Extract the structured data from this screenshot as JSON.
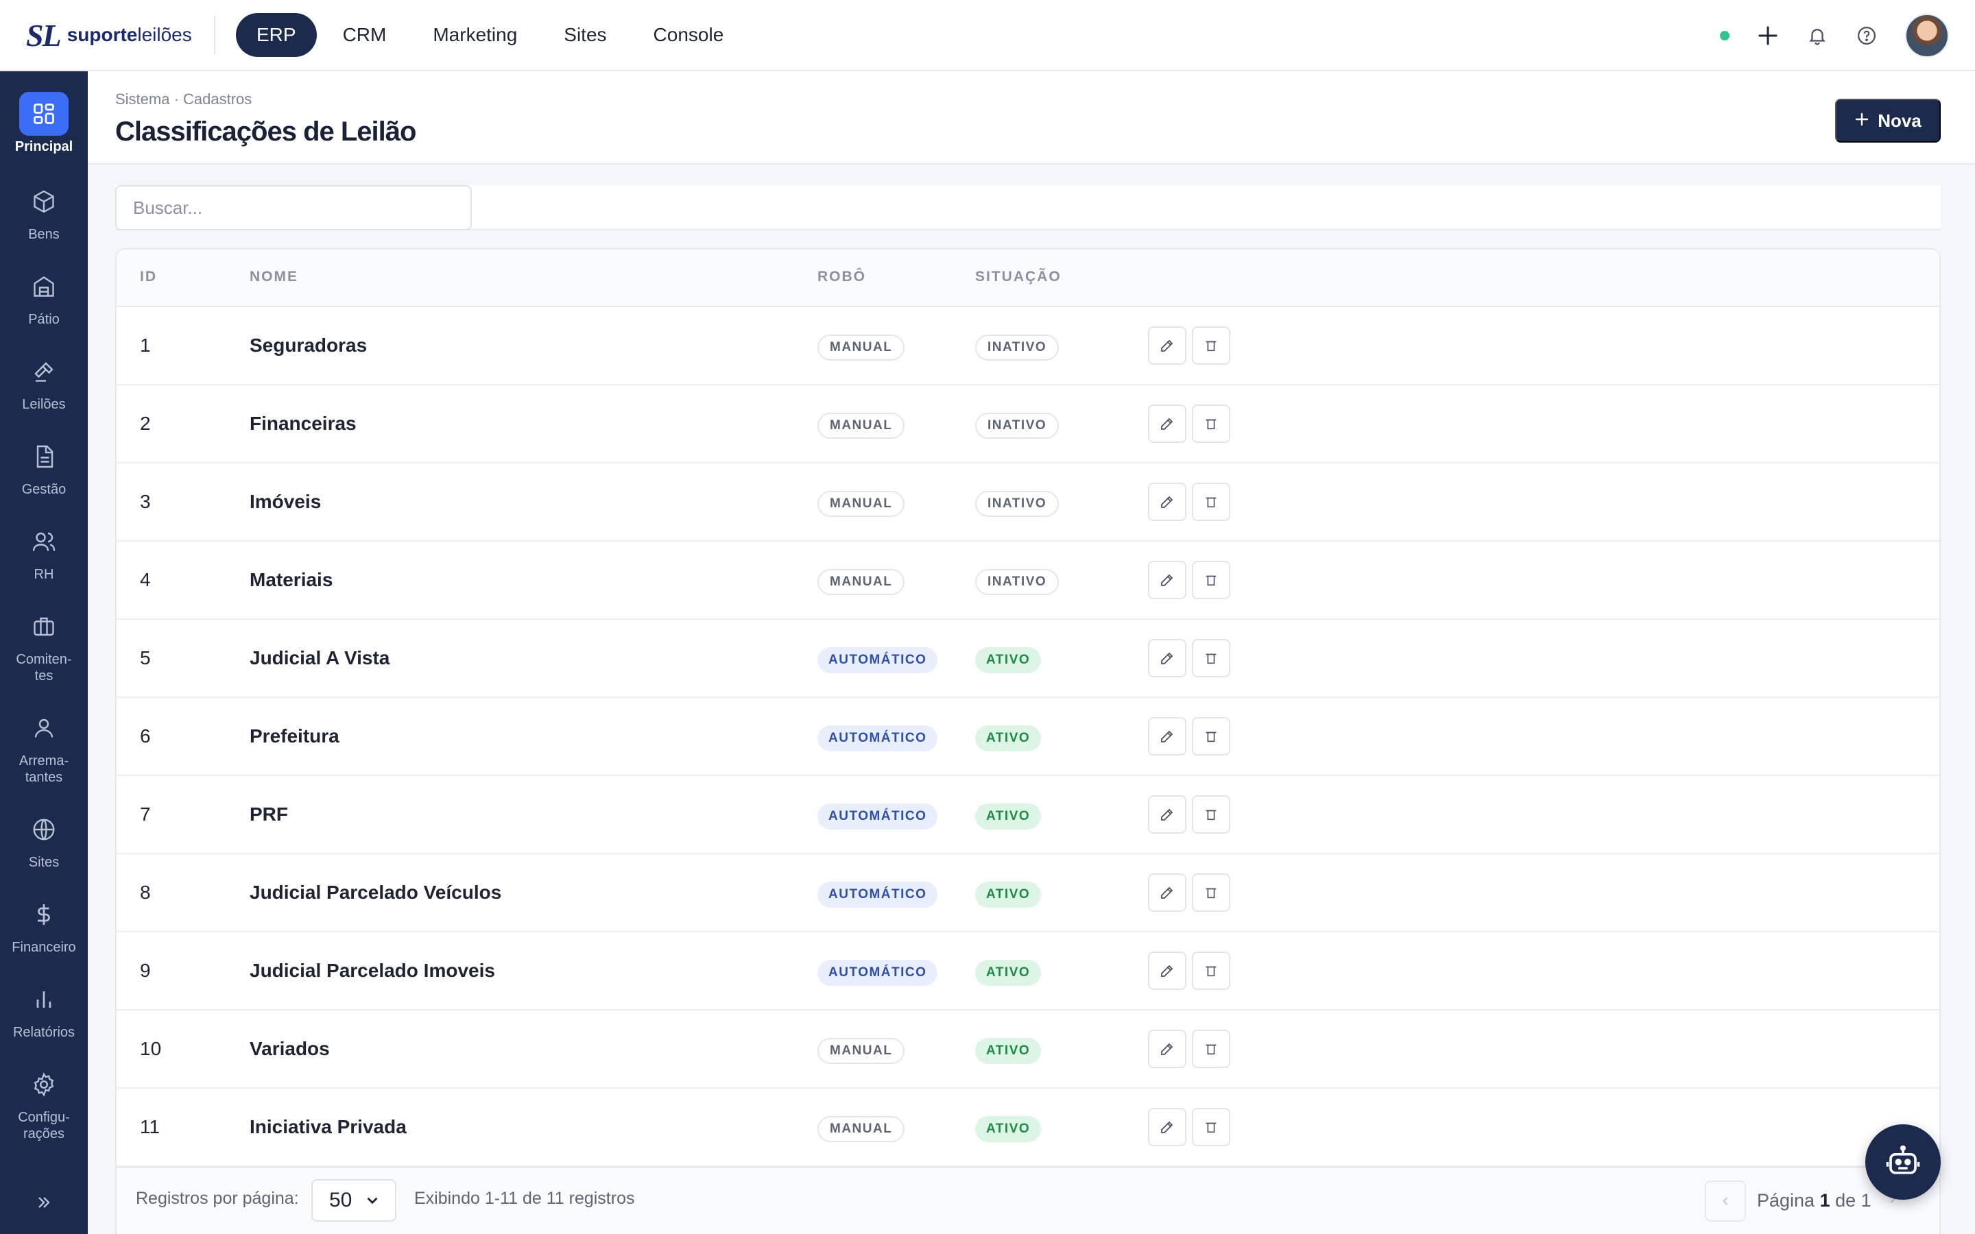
{
  "brand": {
    "mark": "SL",
    "name_bold": "suporte",
    "name_light": "leilões"
  },
  "topnav": [
    {
      "label": "ERP",
      "active": true
    },
    {
      "label": "CRM",
      "active": false
    },
    {
      "label": "Marketing",
      "active": false
    },
    {
      "label": "Sites",
      "active": false
    },
    {
      "label": "Console",
      "active": false
    }
  ],
  "topbar_icons": [
    "status-online-dot",
    "plus-icon",
    "bell-icon",
    "help-icon",
    "user-avatar"
  ],
  "sidebar": [
    {
      "label": "Principal",
      "icon": "dashboard-icon",
      "active": true
    },
    {
      "label": "Bens",
      "icon": "box-icon"
    },
    {
      "label": "Pátio",
      "icon": "warehouse-icon"
    },
    {
      "label": "Leilões",
      "icon": "gavel-icon"
    },
    {
      "label": "Gestão",
      "icon": "document-icon"
    },
    {
      "label": "RH",
      "icon": "users-icon"
    },
    {
      "label": "Comiten-\ntes",
      "icon": "briefcase-icon"
    },
    {
      "label": "Arrema-\ntantes",
      "icon": "user-icon"
    },
    {
      "label": "Sites",
      "icon": "globe-icon"
    },
    {
      "label": "Financeiro",
      "icon": "dollar-icon"
    },
    {
      "label": "Relatórios",
      "icon": "bar-chart-icon"
    },
    {
      "label": "Configu-\nrações",
      "icon": "gear-icon"
    }
  ],
  "page": {
    "breadcrumb": "Sistema · Cadastros",
    "title": "Classificações de Leilão",
    "new_button": "Nova"
  },
  "search": {
    "placeholder": "Buscar..."
  },
  "table": {
    "columns": {
      "id": "ID",
      "name": "NOME",
      "robot": "ROBÔ",
      "status": "SITUAÇÃO"
    },
    "rows": [
      {
        "id": "1",
        "name": "Seguradoras",
        "robot": "MANUAL",
        "status": "INATIVO"
      },
      {
        "id": "2",
        "name": "Financeiras",
        "robot": "MANUAL",
        "status": "INATIVO"
      },
      {
        "id": "3",
        "name": "Imóveis",
        "robot": "MANUAL",
        "status": "INATIVO"
      },
      {
        "id": "4",
        "name": "Materiais",
        "robot": "MANUAL",
        "status": "INATIVO"
      },
      {
        "id": "5",
        "name": "Judicial A Vista",
        "robot": "AUTOMÁTICO",
        "status": "ATIVO"
      },
      {
        "id": "6",
        "name": "Prefeitura",
        "robot": "AUTOMÁTICO",
        "status": "ATIVO"
      },
      {
        "id": "7",
        "name": "PRF",
        "robot": "AUTOMÁTICO",
        "status": "ATIVO"
      },
      {
        "id": "8",
        "name": "Judicial Parcelado Veículos",
        "robot": "AUTOMÁTICO",
        "status": "ATIVO"
      },
      {
        "id": "9",
        "name": "Judicial Parcelado Imoveis",
        "robot": "AUTOMÁTICO",
        "status": "ATIVO"
      },
      {
        "id": "10",
        "name": "Variados",
        "robot": "MANUAL",
        "status": "ATIVO"
      },
      {
        "id": "11",
        "name": "Iniciativa Privada",
        "robot": "MANUAL",
        "status": "ATIVO"
      }
    ]
  },
  "footer": {
    "per_page_label": "Registros por página:",
    "per_page_value": "50",
    "showing": "Exibindo 1-11 de 11 registros",
    "page_prefix": "Página",
    "page_current": "1",
    "page_of": "de 1"
  },
  "colors": {
    "sidebar_bg": "#1c2a4d",
    "accent": "#3b6ef5",
    "active_badge": "#1f8a46",
    "auto_badge": "#2d4fa8"
  }
}
